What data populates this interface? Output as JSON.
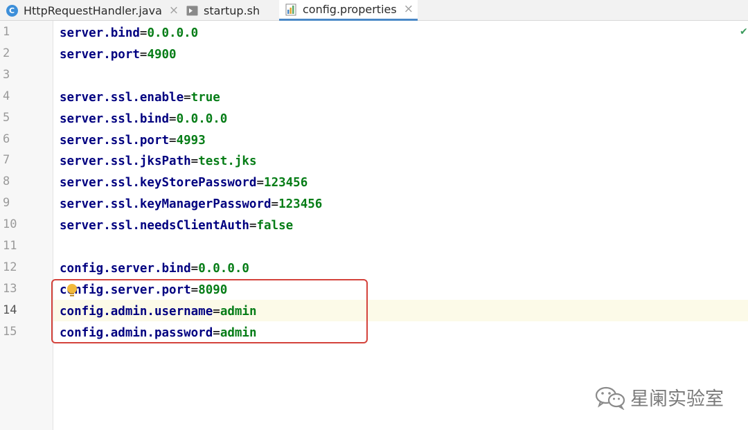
{
  "tabs": [
    {
      "label": "HttpRequestHandler.java",
      "icon": "java-class-icon",
      "icon_letter": "C",
      "close": "×"
    },
    {
      "label": "startup.sh",
      "icon": "shell-script-icon",
      "close": ""
    },
    {
      "label": "config.properties",
      "icon": "properties-file-icon",
      "close": "×",
      "active": true
    }
  ],
  "editor": {
    "line_numbers": [
      "1",
      "2",
      "3",
      "4",
      "5",
      "6",
      "7",
      "8",
      "9",
      "10",
      "11",
      "12",
      "13",
      "14",
      "15"
    ],
    "current_line": 14,
    "lines": [
      {
        "key": "server.bind",
        "value": "0.0.0.0"
      },
      {
        "key": "server.port",
        "value": "4900"
      },
      {
        "key": "",
        "value": ""
      },
      {
        "key": "server.ssl.enable",
        "value": "true"
      },
      {
        "key": "server.ssl.bind",
        "value": "0.0.0.0"
      },
      {
        "key": "server.ssl.port",
        "value": "4993"
      },
      {
        "key": "server.ssl.jksPath",
        "value": "test.jks"
      },
      {
        "key": "server.ssl.keyStorePassword",
        "value": "123456"
      },
      {
        "key": "server.ssl.keyManagerPassword",
        "value": "123456"
      },
      {
        "key": "server.ssl.needsClientAuth",
        "value": "false"
      },
      {
        "key": "",
        "value": ""
      },
      {
        "key": "config.server.bind",
        "value": "0.0.0.0"
      },
      {
        "key": "config.server.port",
        "value": "8090"
      },
      {
        "key": "config.admin.username",
        "value": "admin"
      },
      {
        "key": "config.admin.password",
        "value": "admin"
      }
    ],
    "equals": "="
  },
  "colors": {
    "key": "#000080",
    "value": "#067d17",
    "highlight_box": "#d4423b",
    "current_line_bg": "#fcfae8",
    "active_tab_underline": "#4a88c7"
  },
  "watermark": {
    "text": "星阑实验室",
    "icon": "wechat-icon"
  }
}
